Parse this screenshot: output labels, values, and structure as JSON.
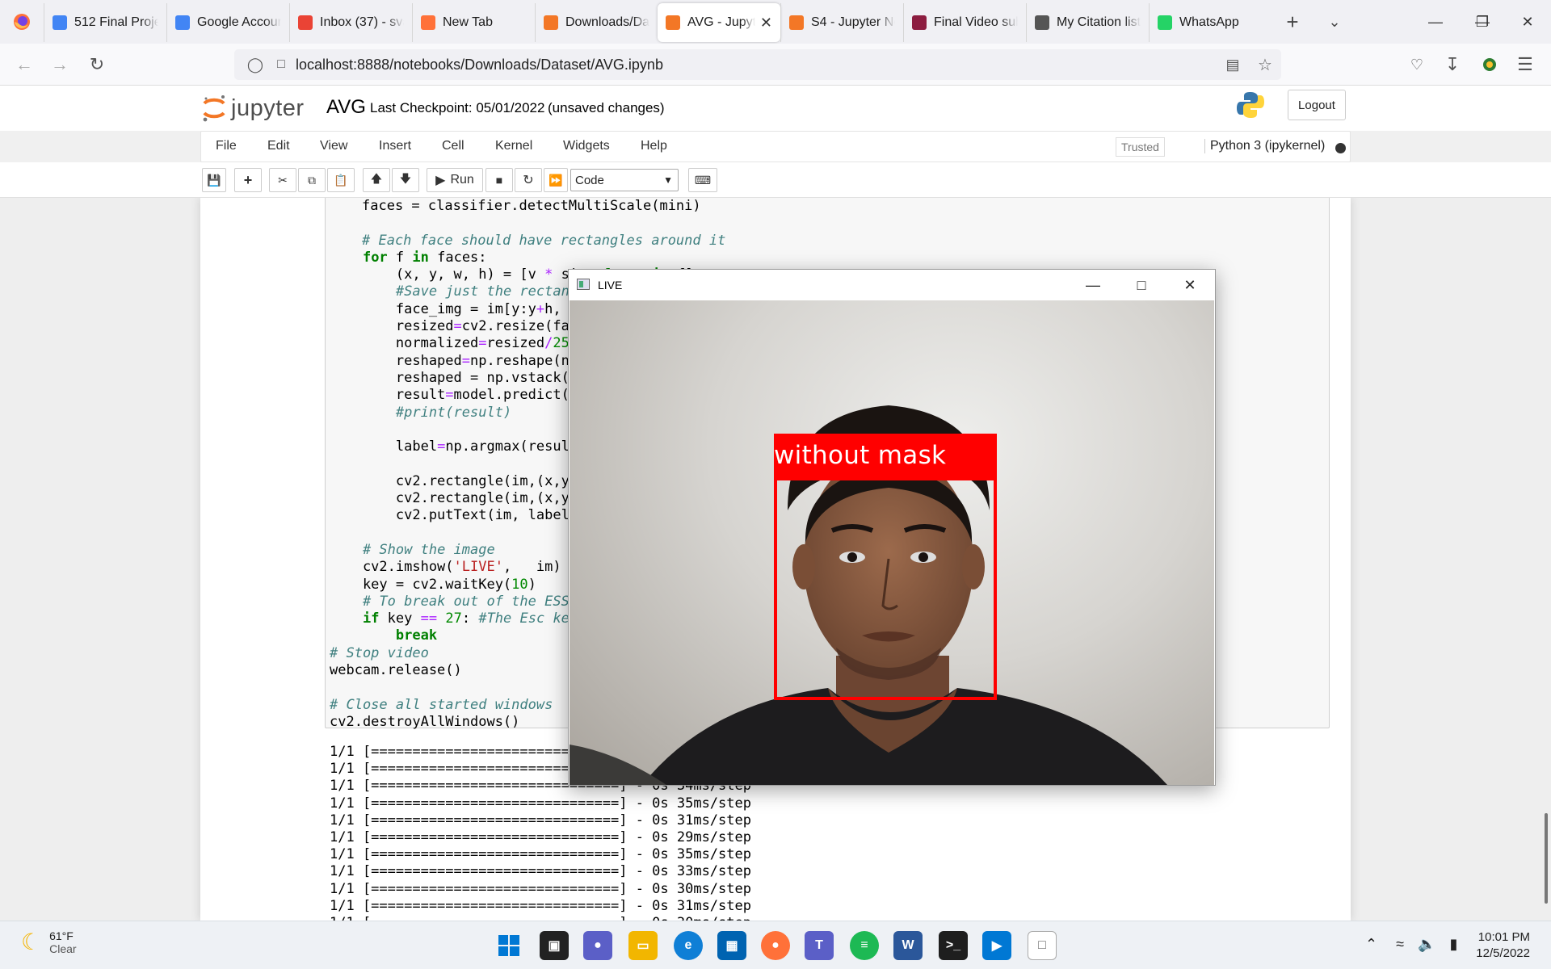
{
  "browser": {
    "tabs": [
      {
        "label": "512 Final Proje",
        "icon": "google-docs-icon",
        "color": "#4285f4"
      },
      {
        "label": "Google Accour",
        "icon": "google-icon",
        "color": "#4285f4"
      },
      {
        "label": "Inbox (37) - sva",
        "icon": "gmail-icon",
        "color": "#ea4335"
      },
      {
        "label": "New Tab",
        "icon": "firefox-icon",
        "color": "#ff7139"
      },
      {
        "label": "Downloads/Da",
        "icon": "jupyter-loading-icon",
        "color": "#f37726"
      },
      {
        "label": "AVG - Jupyte",
        "icon": "jupyter-hourglass-icon",
        "color": "#f37726",
        "active": true
      },
      {
        "label": "S4 - Jupyter No",
        "icon": "jupyter-hourglass-icon",
        "color": "#f37726"
      },
      {
        "label": "Final Video sub",
        "icon": "asu-icon",
        "color": "#8c1d40"
      },
      {
        "label": "My Citation list",
        "icon": "mendeley-icon",
        "color": "#555555"
      },
      {
        "label": "WhatsApp",
        "icon": "whatsapp-icon",
        "color": "#25d366"
      }
    ],
    "url": "localhost:8888/notebooks/Downloads/Dataset/AVG.ipynb"
  },
  "jupyter": {
    "logo_text": "jupyter",
    "notebook_name": "AVG",
    "checkpoint": "Last Checkpoint: 05/01/2022",
    "unsaved": "(unsaved changes)",
    "logout": "Logout",
    "menus": [
      "File",
      "Edit",
      "View",
      "Insert",
      "Cell",
      "Kernel",
      "Widgets",
      "Help"
    ],
    "trusted": "Trusted",
    "kernel": "Python 3 (ipykernel)",
    "run_label": "Run",
    "cell_type": "Code"
  },
  "output_lines": [
    "1/1 [==============================] - 0s 34ms/step",
    "1/1 [==============================] - 0s 35ms/step",
    "1/1 [==============================] - 0s 34ms/step",
    "1/1 [==============================] - 0s 35ms/step",
    "1/1 [==============================] - 0s 31ms/step",
    "1/1 [==============================] - 0s 29ms/step",
    "1/1 [==============================] - 0s 35ms/step",
    "1/1 [==============================] - 0s 33ms/step",
    "1/1 [==============================] - 0s 30ms/step",
    "1/1 [==============================] - 0s 31ms/step",
    "1/1 [==============================] - 0s 30ms/step"
  ],
  "live_window": {
    "title": "LIVE",
    "detection_label": "without mask"
  },
  "taskbar": {
    "temperature": "61°F",
    "condition": "Clear",
    "time": "10:01 PM",
    "date": "12/5/2022"
  }
}
